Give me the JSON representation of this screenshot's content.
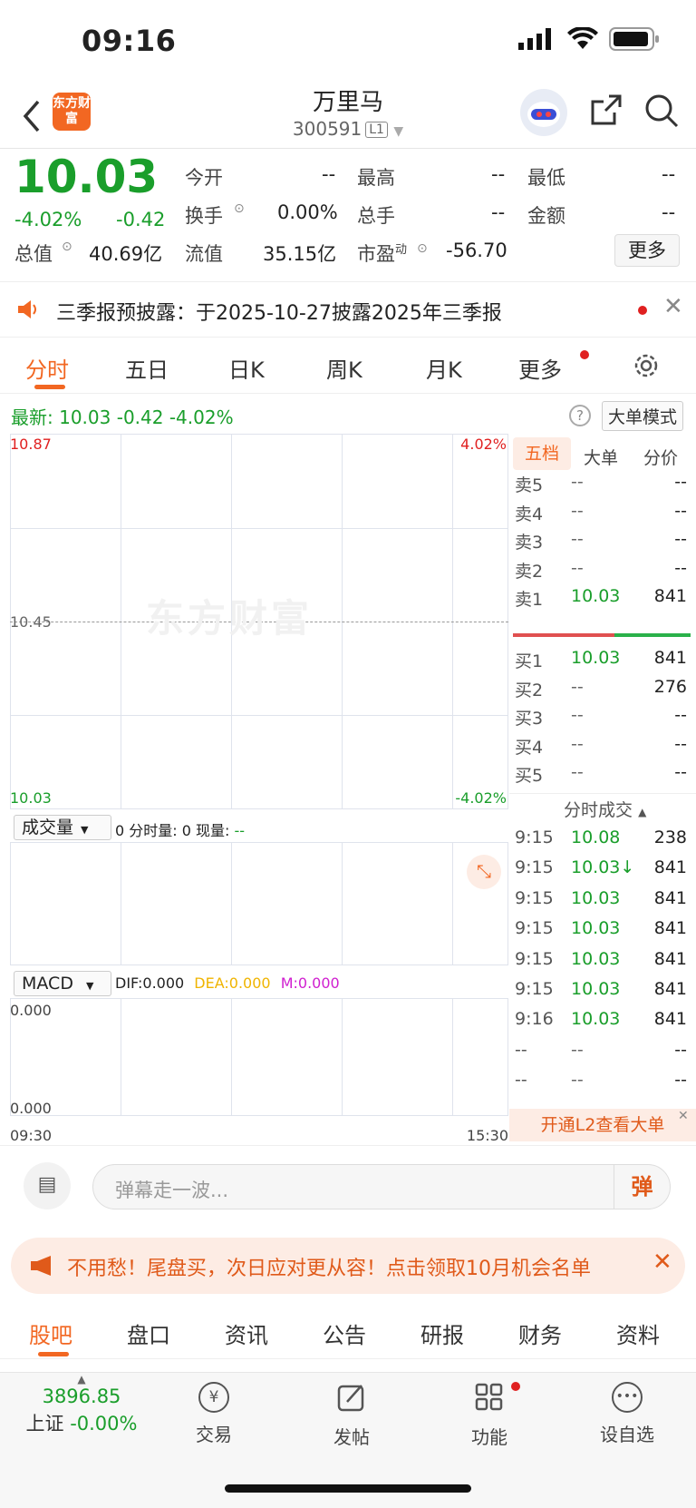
{
  "status": {
    "time": "09:16"
  },
  "header": {
    "title": "万里马",
    "code": "300591",
    "level": "L1",
    "logo": "东方财富"
  },
  "quote": {
    "price": "10.03",
    "change_pct": "-4.02%",
    "change": "-0.42",
    "open_label": "今开",
    "open": "--",
    "high_label": "最高",
    "high": "--",
    "low_label": "最低",
    "low": "--",
    "turnover_label": "换手",
    "turnover": "0.00%",
    "volume_label": "总手",
    "volume": "--",
    "amount_label": "金额",
    "amount": "--",
    "mktcap_label": "总值",
    "mktcap": "40.69亿",
    "float_label": "流值",
    "float": "35.15亿",
    "pe_label": "市盈",
    "pe_sup": "动",
    "pe": "-56.70",
    "more": "更多"
  },
  "notice": {
    "text": "三季报预披露：于2025-10-27披露2025年三季报"
  },
  "tabs": [
    "分时",
    "五日",
    "日K",
    "周K",
    "月K",
    "更多"
  ],
  "latest": {
    "label": "最新:",
    "price": "10.03",
    "change": "-0.42",
    "pct": "-4.02%",
    "mode": "大单模式"
  },
  "chart": {
    "y_top": "10.87",
    "y_mid": "10.45",
    "y_bot": "10.03",
    "pct_top": "4.02%",
    "pct_bot": "-4.02%",
    "watermark": "东方财富",
    "vol_select": "成交量",
    "vol_info": "0 分时量: 0 现量:",
    "vol_cur": "--",
    "macd_select": "MACD",
    "dif": "DIF:0.000",
    "dea": "DEA:0.000",
    "m": "M:0.000",
    "macd_top": "0.000",
    "macd_bot": "0.000",
    "t_start": "09:30",
    "t_end": "15:30"
  },
  "side": {
    "tabs": [
      "五档",
      "大单",
      "分价"
    ],
    "asks": [
      {
        "label": "卖5",
        "price": "--",
        "vol": "--"
      },
      {
        "label": "卖4",
        "price": "--",
        "vol": "--"
      },
      {
        "label": "卖3",
        "price": "--",
        "vol": "--"
      },
      {
        "label": "卖2",
        "price": "--",
        "vol": "--"
      },
      {
        "label": "卖1",
        "price": "10.03",
        "vol": "841"
      }
    ],
    "bids": [
      {
        "label": "买1",
        "price": "10.03",
        "vol": "841"
      },
      {
        "label": "买2",
        "price": "--",
        "vol": "276"
      },
      {
        "label": "买3",
        "price": "--",
        "vol": "--"
      },
      {
        "label": "买4",
        "price": "--",
        "vol": "--"
      },
      {
        "label": "买5",
        "price": "--",
        "vol": "--"
      }
    ],
    "trades_title": "分时成交",
    "trades": [
      {
        "time": "9:15",
        "price": "10.08",
        "vol": "238"
      },
      {
        "time": "9:15",
        "price": "10.03↓",
        "vol": "841"
      },
      {
        "time": "9:15",
        "price": "10.03",
        "vol": "841"
      },
      {
        "time": "9:15",
        "price": "10.03",
        "vol": "841"
      },
      {
        "time": "9:15",
        "price": "10.03",
        "vol": "841"
      },
      {
        "time": "9:15",
        "price": "10.03",
        "vol": "841"
      },
      {
        "time": "9:16",
        "price": "10.03",
        "vol": "841"
      },
      {
        "time": "--",
        "price": "--",
        "vol": "--"
      },
      {
        "time": "--",
        "price": "--",
        "vol": "--"
      }
    ],
    "l2": "开通L2查看大单"
  },
  "danmu": {
    "placeholder": "弹幕走一波...",
    "btn": "弹"
  },
  "promo": {
    "text": "不用愁！尾盘买，次日应对更从容！点击领取10月机会名单"
  },
  "bottom_tabs": [
    "股吧",
    "盘口",
    "资讯",
    "公告",
    "研报",
    "财务",
    "资料"
  ],
  "tabbar": {
    "index_value": "3896.85",
    "index_name": "上证",
    "index_pct": "-0.00%",
    "items": [
      "交易",
      "发帖",
      "功能",
      "设自选"
    ]
  },
  "colors": {
    "accent": "#f26722",
    "down": "#1a9e2b",
    "up": "#e02020"
  }
}
